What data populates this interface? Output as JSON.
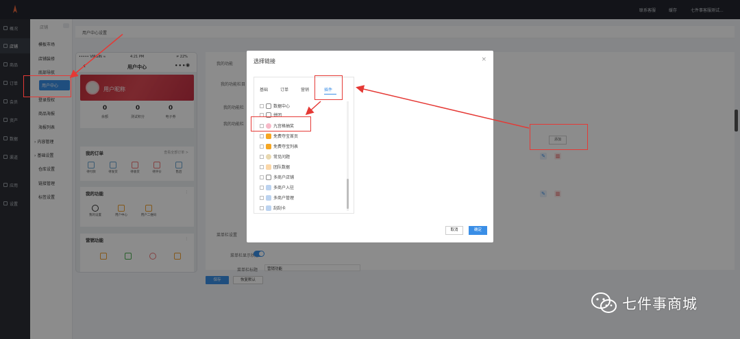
{
  "topbar": {
    "links": [
      "联系客服",
      "缓存",
      "七件事客服测试..."
    ]
  },
  "left_nav": [
    "概况",
    "店铺",
    "商品",
    "订单",
    "会员",
    "资产",
    "数据",
    "渠道",
    "应用",
    "设置"
  ],
  "sub_nav": {
    "title": "店铺",
    "items": [
      "模板市场",
      "店铺装修",
      "底部导航",
      "用户中心",
      "登录授权",
      "商品海报",
      "海报列表",
      "内容管理",
      "基础设置",
      "仓库设置",
      "链接管理",
      "标签设置"
    ]
  },
  "breadcrumb": "用户中心设置",
  "phone": {
    "status_left": "••••• VIRGIN ≈",
    "status_time": "4:21 PM",
    "status_right": "≠ 22%",
    "title": "用户中心",
    "nickname": "用户昵称",
    "stats": [
      {
        "value": "0",
        "label": "余额"
      },
      {
        "value": "0",
        "label": "测试积分"
      },
      {
        "value": "0",
        "label": "电子券"
      }
    ],
    "orders_title": "我的订单",
    "orders_link": "查看全部订单 >",
    "order_icons": [
      "待付款",
      "待发货",
      "待收货",
      "待评价",
      "售后"
    ],
    "functions_title": "我的功能",
    "function_icons": [
      "我的设置",
      "用户中心",
      "用户二维码"
    ],
    "marketing_title": "营销功能"
  },
  "panel": {
    "labels": [
      "我的功能",
      "我的功能栏目",
      "我的功能栏",
      "我的功能栏",
      "菜单栏设置",
      "菜单栏显示状态",
      "菜单栏标题"
    ],
    "add_button": "添加",
    "menu_title_value": "营销功能",
    "save": "保存",
    "reset": "恢复默认"
  },
  "modal": {
    "title": "选择链接",
    "close": "×",
    "tabs": [
      "基础",
      "订单",
      "营销",
      "插件"
    ],
    "active_tab": "插件",
    "items": [
      "数据中心",
      "拼团",
      "九宫格抽奖",
      "免费夺宝首页",
      "免费夺宝列表",
      "常见问题",
      "团队数据",
      "多商户店铺",
      "多商户入驻",
      "多商户管理",
      "刮刮卡"
    ],
    "cancel": "取消",
    "ok": "确定"
  },
  "watermark": "七件事商城",
  "colors": {
    "primary": "#3a8ee6",
    "highlight": "#e53935",
    "banner": "#d63a46",
    "dark_nav": "#23262e"
  }
}
